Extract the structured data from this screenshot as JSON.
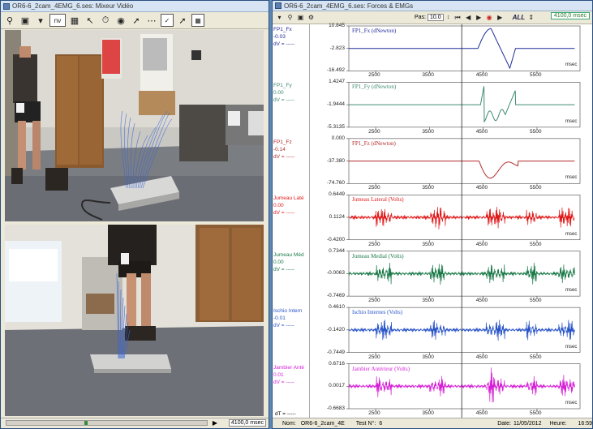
{
  "left_window": {
    "title": "OR6-6_2cam_4EMG_6.ses: Mixeur Vidéo",
    "toolbar_nv": "nv",
    "time_readout": "4100,0 msec"
  },
  "right_window": {
    "title": "OR6-6_2cam_4EMG_6.ses: Forces & EMGs",
    "pas_label": "Pas:",
    "pas_value": "10.0",
    "all_label": "ALL",
    "time_readout": "4100,0 msec",
    "footer": {
      "nom_label": "Nom:",
      "nom_value": "OR6-6_2cam_4E",
      "test_label": "Test N°:",
      "test_value": "6",
      "date_label": "Date:",
      "date_value": "11/05/2012",
      "heure_label": "Heure:",
      "heure_value": "16:59"
    },
    "dt_label": "dT = -----"
  },
  "x_ticks": [
    "2500",
    "3500",
    "4500",
    "5500"
  ],
  "x_unit": "msec",
  "channels": [
    {
      "short": "FP1_Fx",
      "value": "-0.03",
      "dv": "dV = -----",
      "name": "FP1_Fx (dNewton)",
      "ticks": [
        "10.845",
        "-2.823",
        "-16.492"
      ],
      "color": "#1f2a9a"
    },
    {
      "short": "FP1_Fy",
      "value": "0.00",
      "dv": "dV = -----",
      "name": "FP1_Fy (dNewton)",
      "ticks": [
        "1.4247",
        "-1.9444",
        "-5.3135"
      ],
      "color": "#3e8a6e"
    },
    {
      "short": "FP1_Fz",
      "value": "-0.14",
      "dv": "dV = -----",
      "name": "FP1_Fz (dNewton)",
      "ticks": [
        "0.000",
        "-37.380",
        "-74.760"
      ],
      "color": "#b42a2a"
    },
    {
      "short": "Jumeau Laté",
      "value": "0.00",
      "dv": "dV = -----",
      "name": "Jumeau Lateral (Volts)",
      "ticks": [
        "0.6449",
        "0.1124",
        "-0.4200"
      ],
      "color": "#e01818"
    },
    {
      "short": "Jumeau Méd",
      "value": "0.00",
      "dv": "dV = -----",
      "name": "Jumeau Medial (Volts)",
      "ticks": [
        "0.7344",
        "-0.0063",
        "-0.7469"
      ],
      "color": "#1c7a4a"
    },
    {
      "short": "Ischio Intern",
      "value": "-0.01",
      "dv": "dV = -----",
      "name": "Ischio Internes (Volts)",
      "ticks": [
        "0.4610",
        "-0.1420",
        "-0.7449"
      ],
      "color": "#2a55c8"
    },
    {
      "short": "Jambier Anté",
      "value": "0.01",
      "dv": "dV = -----",
      "name": "Jambier Antérieur (Volts)",
      "ticks": [
        "0.6716",
        "0.0017",
        "-0.6683"
      ],
      "color": "#d61fd6"
    }
  ]
}
